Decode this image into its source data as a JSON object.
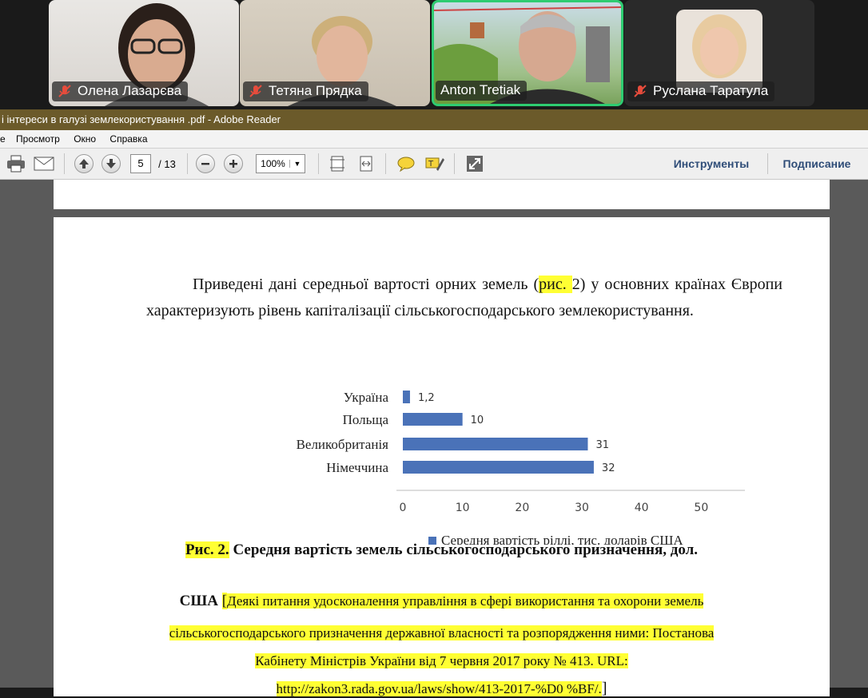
{
  "participants": [
    {
      "name": "Олена Лазарєва",
      "muted": true
    },
    {
      "name": "Тетяна Прядка",
      "muted": true
    },
    {
      "name": "Anton Tretiak",
      "muted": false,
      "active": true
    },
    {
      "name": "Руслана Таратула",
      "muted": true
    }
  ],
  "window": {
    "title": "і інтереси в галузі землекористування .pdf - Adobe Reader"
  },
  "menu": [
    "е",
    "Просмотр",
    "Окно",
    "Справка"
  ],
  "toolbar": {
    "page_current": "5",
    "page_total": "/ 13",
    "zoom": "100%",
    "tools_label": "Инструменты",
    "sign_label": "Подписание"
  },
  "document": {
    "para_a": "Приведені дані середньої вартості орних земель (",
    "para_ref": "рис. ",
    "para_b": "2) у основних країнах Європи характеризують рівень капіталізації сільськогосподарського землекористування.",
    "caption_label": "Рис. 2.",
    "caption_title_1": " Середня вартість земель сільськогосподарського призначення, дол.",
    "caption_title_2": "США ",
    "source_bracket_open": "[",
    "source_1": "Деякі питання удосконалення управління в сфері використання та охорони земель",
    "source_2": "сільськогосподарського призначення державної власності та розпорядження ними: Постанова",
    "source_3": "Кабінету Міністрів України від 7 червня 2017 року № 413. URL:",
    "source_4": "http://zakon3.rada.gov.ua/laws/show/413-2017-%D0 %BF/.",
    "source_bracket_close": "]"
  },
  "chart_data": {
    "type": "bar",
    "orientation": "horizontal",
    "categories": [
      "Україна",
      "Польща",
      "Великобританія",
      "Німеччина"
    ],
    "series": [
      {
        "name": "Середня вартість ріллі, тис. доларів США",
        "values": [
          1.2,
          10,
          31,
          32
        ]
      }
    ],
    "value_labels": [
      "1,2",
      "10",
      "31",
      "32"
    ],
    "xlim": [
      0,
      60
    ],
    "xticks": [
      0,
      10,
      20,
      30,
      40,
      50,
      60
    ],
    "bar_color": "#4a72b8",
    "legend": "bottom"
  }
}
